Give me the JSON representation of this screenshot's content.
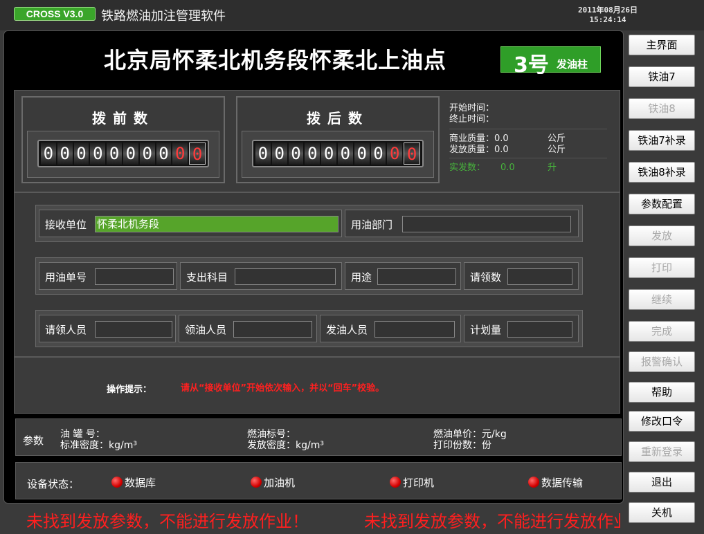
{
  "app": {
    "version": "CROSS V3.0",
    "title": "铁路燃油加注管理软件",
    "date": "2011年08月26日",
    "time": "15:24:14"
  },
  "station": {
    "title": "北京局怀柔北机务段怀柔北上油点",
    "pump_number": "3号",
    "pump_label": "发油柱"
  },
  "meters": {
    "before": {
      "title": "拨前数",
      "digits": [
        "0",
        "0",
        "0",
        "0",
        "0",
        "0",
        "0",
        "0",
        "0",
        "0"
      ]
    },
    "after": {
      "title": "拨后数",
      "digits": [
        "0",
        "0",
        "0",
        "0",
        "0",
        "0",
        "0",
        "0",
        "0",
        "0"
      ]
    }
  },
  "info": {
    "start_time_label": "开始时间：",
    "end_time_label": "终止时间：",
    "commercial_mass_label": "商业质量：",
    "commercial_mass_value": "0.0",
    "commercial_mass_unit": "公斤",
    "dispatch_mass_label": "发放质量：",
    "dispatch_mass_value": "0.0",
    "dispatch_mass_unit": "公斤",
    "actual_label": "实发数：",
    "actual_value": "0.0",
    "actual_unit": "升"
  },
  "form": {
    "receiver_label": "接收单位",
    "receiver_value": "怀柔北机务段",
    "department_label": "用油部门",
    "department_value": "",
    "order_no_label": "用油单号",
    "order_no_value": "",
    "expense_label": "支出科目",
    "expense_value": "",
    "purpose_label": "用途",
    "purpose_value": "",
    "request_qty_label": "请领数",
    "request_qty_value": "",
    "requester_label": "请领人员",
    "requester_value": "",
    "receiver_person_label": "领油人员",
    "receiver_person_value": "",
    "dispatcher_label": "发油人员",
    "dispatcher_value": "",
    "plan_label": "计划量",
    "plan_value": ""
  },
  "hint": {
    "label": "操作提示：",
    "text": "请从“接收单位”开始依次输入，并以“回车”校验。"
  },
  "params": {
    "title": "参数",
    "tank_no": "油 罐 号：",
    "std_density": "标准密度：kg/m³",
    "fuel_grade": "燃油标号：",
    "dispatch_density": "发放密度：kg/m³",
    "unit_price": "燃油单价：元/kg",
    "print_copies": "打印份数：份"
  },
  "status": {
    "label": "设备状态：",
    "items": [
      "数据库",
      "加油机",
      "打印机",
      "数据传输"
    ],
    "status_color": "#d40000"
  },
  "marquee": {
    "message": "未找到发放参数，不能进行发放作业！"
  },
  "sidebar": {
    "buttons": [
      {
        "label": "主界面",
        "enabled": true
      },
      {
        "label": "铁油7",
        "enabled": true
      },
      {
        "label": "铁油8",
        "enabled": false
      },
      {
        "label": "铁油7补录",
        "enabled": true
      },
      {
        "label": "铁油8补录",
        "enabled": true
      },
      {
        "label": "参数配置",
        "enabled": true
      },
      {
        "label": "发放",
        "enabled": false
      },
      {
        "label": "打印",
        "enabled": false
      },
      {
        "label": "继续",
        "enabled": false
      },
      {
        "label": "完成",
        "enabled": false
      },
      {
        "label": "报警确认",
        "enabled": false
      },
      {
        "label": "帮助",
        "enabled": true
      },
      {
        "label": "修改口令",
        "enabled": true
      },
      {
        "label": "重新登录",
        "enabled": false
      },
      {
        "label": "退出",
        "enabled": true
      },
      {
        "label": "关机",
        "enabled": true
      }
    ]
  }
}
